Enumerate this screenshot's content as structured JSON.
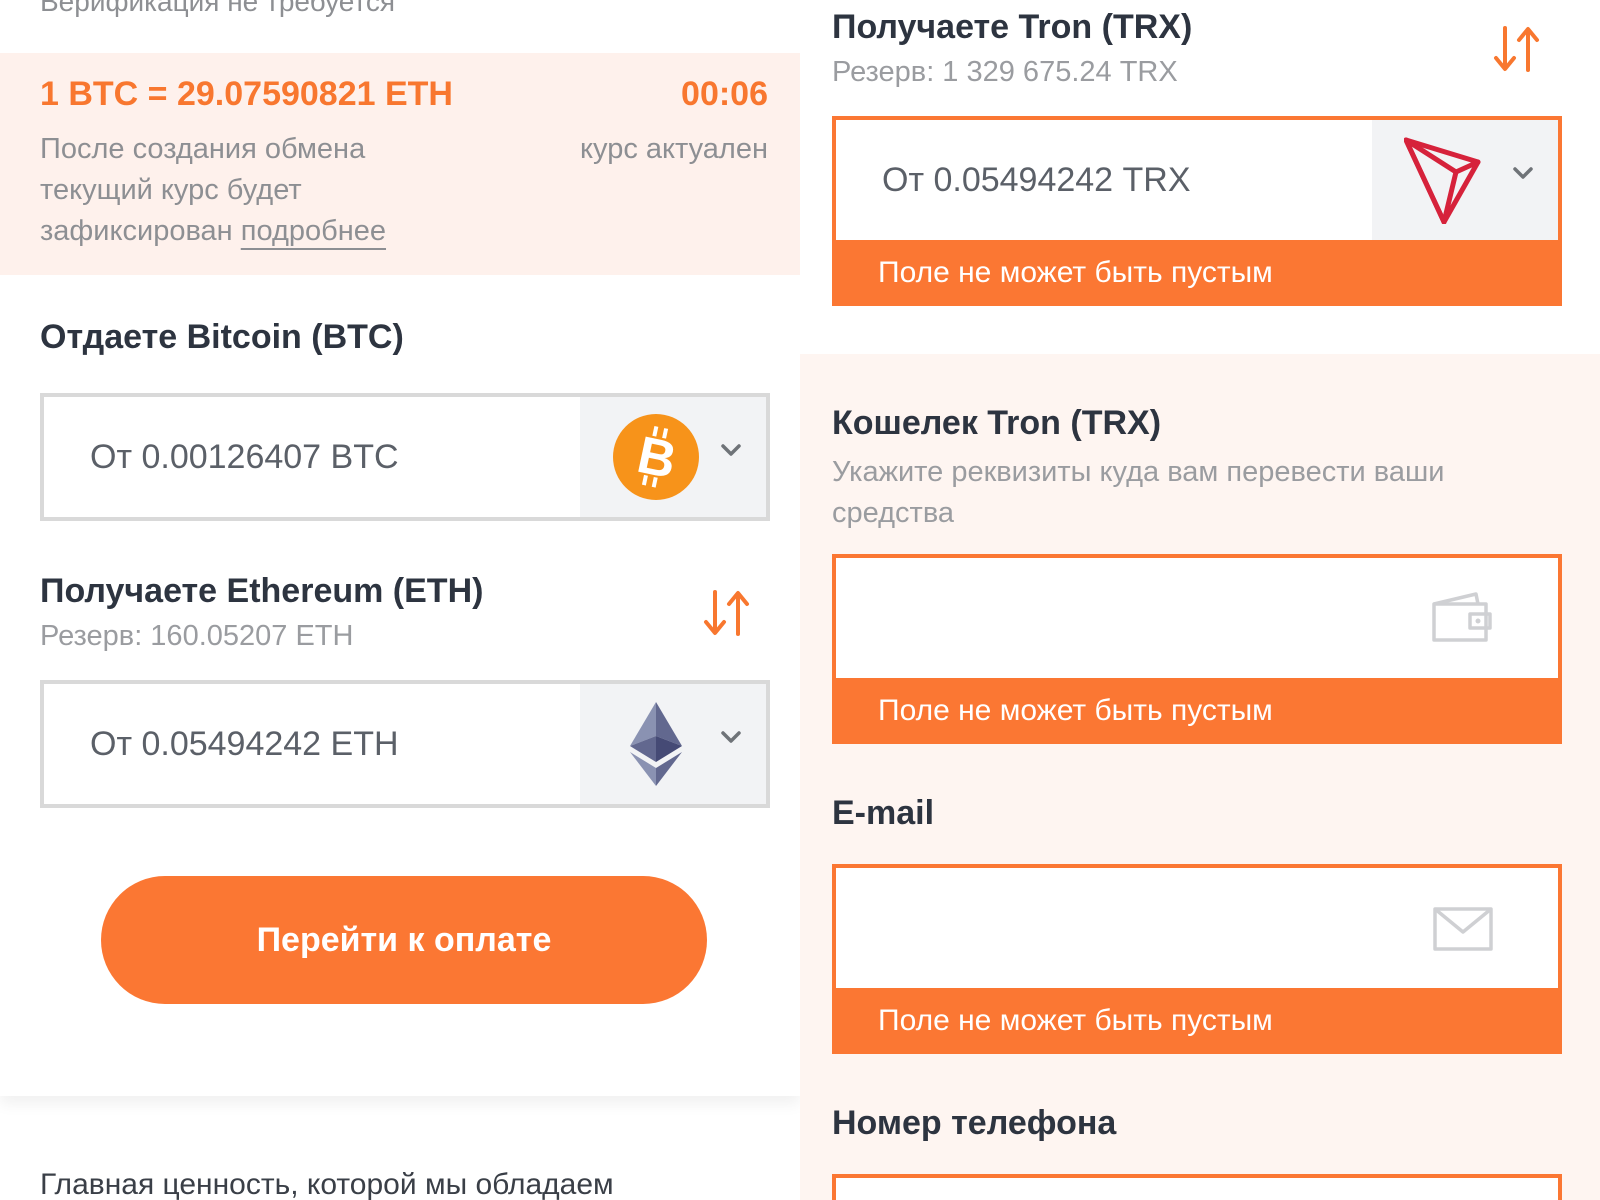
{
  "left": {
    "verification_text": "Верификация не требуется",
    "rate": {
      "line": "1 BTC = 29.07590821 ETH",
      "timer": "00:06",
      "note": "После создания обмена текущий курс будет зафиксирован",
      "more_link": "подробнее",
      "status": "курс актуален"
    },
    "send": {
      "title": "Отдаете Bitcoin (BTC)",
      "placeholder": "От 0.00126407 BTC",
      "coin_icon": "bitcoin-icon",
      "coin_color": "#f7931a"
    },
    "receive": {
      "title": "Получаете Ethereum (ETH)",
      "reserve": "Резерв: 160.05207 ETH",
      "placeholder": "От 0.05494242 ETH",
      "coin_icon": "ethereum-icon"
    },
    "pay_button": "Перейти к оплате",
    "footer_text": "Главная ценность, которой мы обладаем"
  },
  "right": {
    "receive": {
      "title": "Получаете Tron (TRX)",
      "reserve": "Резерв: 1 329 675.24 TRX",
      "placeholder": "От 0.05494242 TRX",
      "coin_icon": "tron-icon",
      "coin_color": "#d6223b",
      "error": "Поле не может быть пустым"
    },
    "wallet": {
      "title": "Кошелек Tron (TRX)",
      "hint": "Укажите реквизиты куда вам перевести ваши средства",
      "value": "",
      "icon": "wallet-icon",
      "error": "Поле не может быть пустым"
    },
    "email": {
      "title": "E-mail",
      "value": "",
      "icon": "mail-icon",
      "error": "Поле не может быть пустым"
    },
    "phone": {
      "title": "Номер телефона"
    }
  },
  "colors": {
    "accent": "#fb7733",
    "rate_background": "#fef1ec",
    "muted_text": "#8d8f93",
    "heading_text": "#2d3440"
  }
}
